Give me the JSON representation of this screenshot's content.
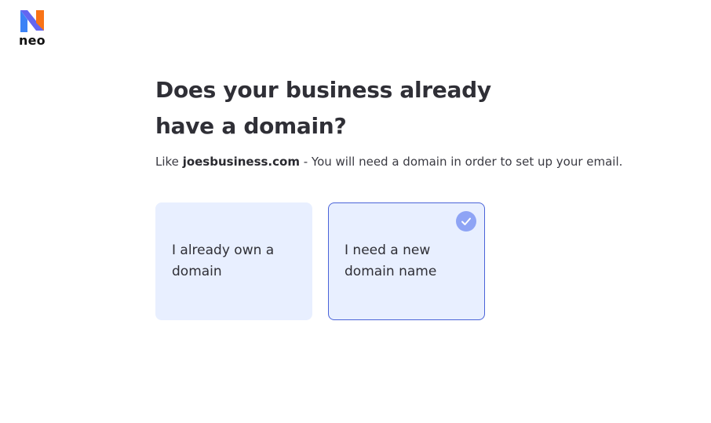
{
  "logo": {
    "name": "neo",
    "colors": {
      "blue": "#3b82f6",
      "orange": "#f97316",
      "text": "#111111"
    }
  },
  "question": {
    "title": "Does your business already have a domain?",
    "subtitle_prefix": "Like ",
    "subtitle_example": "joesbusiness.com",
    "subtitle_suffix": " - You will need a domain in order to set up your email."
  },
  "options": [
    {
      "label": "I already own a domain",
      "selected": false
    },
    {
      "label": "I need a new domain name",
      "selected": true
    }
  ],
  "colors": {
    "card_bg": "#e8efff",
    "selected_border": "#4a63d8",
    "check_bg": "#8ea4f5"
  },
  "icons": {
    "selected": "check-circle-icon",
    "brand": "neo-logo-icon"
  }
}
